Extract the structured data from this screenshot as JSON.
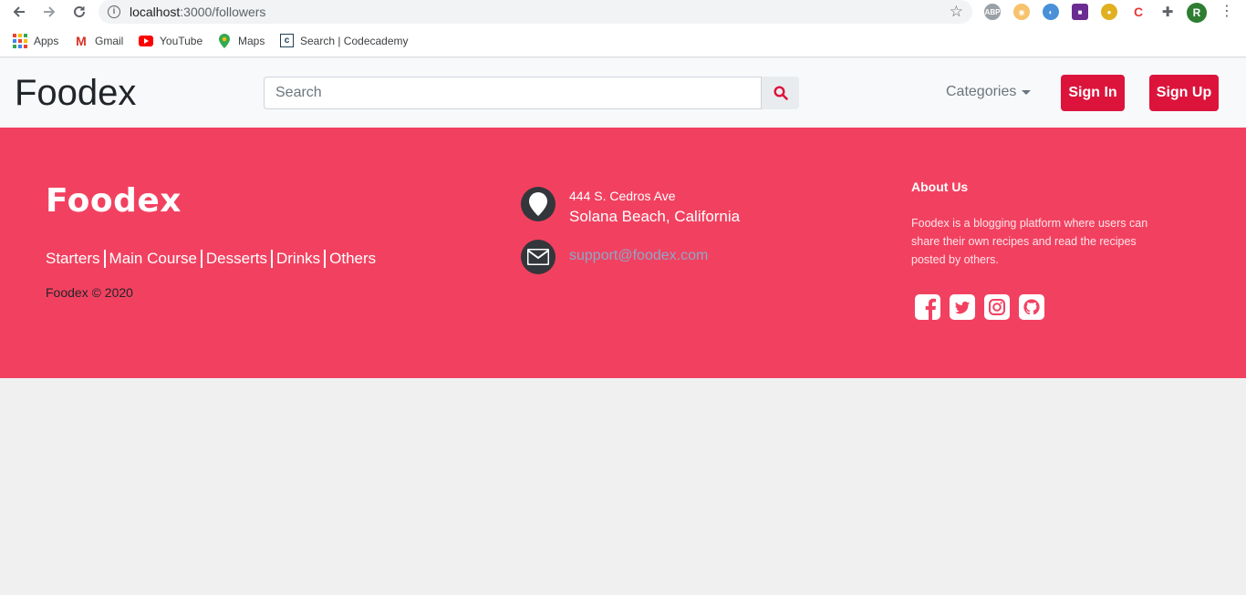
{
  "browser": {
    "url_host": "localhost",
    "url_path": ":3000/followers",
    "profile_initial": "R",
    "extensions": [
      "abp-icon",
      "extension-face-icon",
      "extension-blue-icon",
      "extension-purple-icon",
      "extension-yellow-icon",
      "extension-c-icon",
      "puzzle-icon"
    ],
    "bookmarks": [
      {
        "label": "Apps"
      },
      {
        "label": "Gmail"
      },
      {
        "label": "YouTube"
      },
      {
        "label": "Maps"
      },
      {
        "label": "Search | Codecademy"
      }
    ]
  },
  "navbar": {
    "brand": "Foodex",
    "search_placeholder": "Search",
    "categories_label": "Categories",
    "signin_label": "Sign In",
    "signup_label": "Sign Up",
    "accent": "#dc143c"
  },
  "footer": {
    "brand": "Foodex",
    "links": [
      "Starters",
      "Main Course",
      "Desserts",
      "Drinks",
      "Others"
    ],
    "copyright": "Foodex © 2020",
    "address_line1": "444 S. Cedros Ave",
    "address_line2": "Solana Beach, California",
    "email": "support@foodex.com",
    "about_title": "About Us",
    "about_text": "Foodex is a blogging platform where users can share their own recipes and read the recipes posted by others.",
    "socials": [
      "facebook-icon",
      "twitter-icon",
      "instagram-icon",
      "github-icon"
    ],
    "background": "#f24160"
  }
}
